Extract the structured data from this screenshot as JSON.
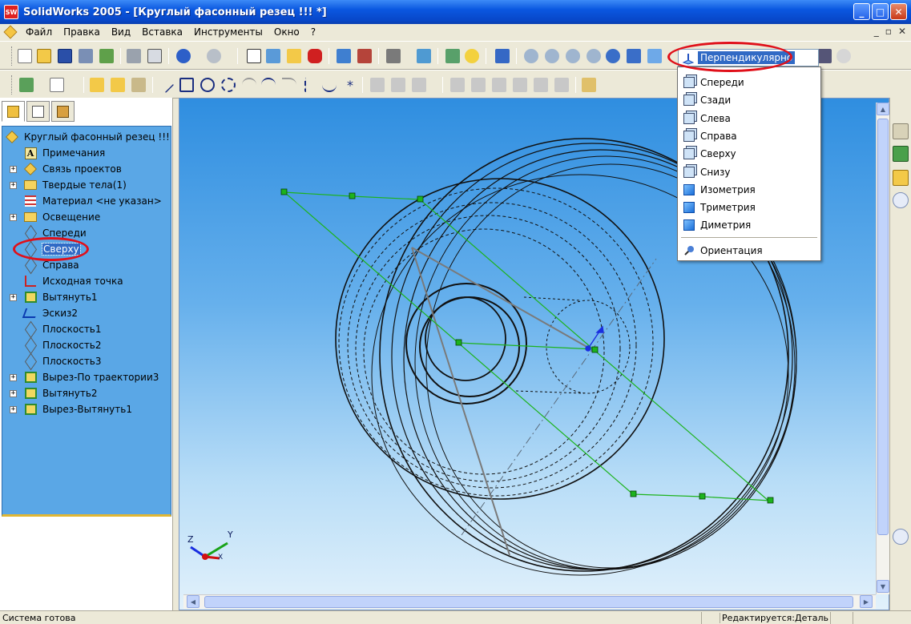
{
  "window": {
    "title": "SolidWorks 2005 - [Круглый фасонный резец !!! *]",
    "app_icon_text": "SW",
    "minimize_glyph": "_",
    "maximize_glyph": "□",
    "close_glyph": "✕"
  },
  "menu": {
    "items": [
      "Файл",
      "Правка",
      "Вид",
      "Вставка",
      "Инструменты",
      "Окно",
      "?"
    ],
    "doc_controls": [
      "_",
      "▫",
      "✕"
    ]
  },
  "feature_tree": {
    "root": "Круглый фасонный резец !!!",
    "items": [
      {
        "label": "Примечания",
        "icon": "annotation-icon",
        "expand": ""
      },
      {
        "label": "Связь проектов",
        "icon": "link-icon",
        "expand": "+"
      },
      {
        "label": "Твердые тела(1)",
        "icon": "folder-icon",
        "expand": "+"
      },
      {
        "label": "Материал <не указан>",
        "icon": "material-icon",
        "expand": ""
      },
      {
        "label": "Освещение",
        "icon": "light-folder-icon",
        "expand": "+"
      },
      {
        "label": "Спереди",
        "icon": "plane-icon",
        "expand": ""
      },
      {
        "label": "Сверху",
        "icon": "plane-icon",
        "expand": "",
        "selected": true
      },
      {
        "label": "Справа",
        "icon": "plane-icon",
        "expand": ""
      },
      {
        "label": "Исходная точка",
        "icon": "origin-icon",
        "expand": ""
      },
      {
        "label": "Вытянуть1",
        "icon": "extrude-icon",
        "expand": "+"
      },
      {
        "label": "Эскиз2",
        "icon": "sketch-icon",
        "expand": ""
      },
      {
        "label": "Плоскость1",
        "icon": "plane-icon",
        "expand": ""
      },
      {
        "label": "Плоскость2",
        "icon": "plane-icon",
        "expand": ""
      },
      {
        "label": "Плоскость3",
        "icon": "plane-icon",
        "expand": ""
      },
      {
        "label": "Вырез-По траектории3",
        "icon": "sweep-cut-icon",
        "expand": "+"
      },
      {
        "label": "Вытянуть2",
        "icon": "extrude-icon",
        "expand": "+"
      },
      {
        "label": "Вырез-Вытянуть1",
        "icon": "extrude-cut-icon",
        "expand": "+"
      }
    ]
  },
  "view_orientation": {
    "current": "Перпендикулярно",
    "options": [
      {
        "label": "Спереди",
        "icon": "wire-cube-icon"
      },
      {
        "label": "Сзади",
        "icon": "wire-cube-icon"
      },
      {
        "label": "Слева",
        "icon": "wire-cube-icon"
      },
      {
        "label": "Справа",
        "icon": "wire-cube-icon"
      },
      {
        "label": "Сверху",
        "icon": "wire-cube-icon"
      },
      {
        "label": "Снизу",
        "icon": "wire-cube-icon"
      },
      {
        "label": "Изометрия",
        "icon": "solid-cube-icon"
      },
      {
        "label": "Триметрия",
        "icon": "solid-cube-icon"
      },
      {
        "label": "Диметрия",
        "icon": "solid-cube-icon"
      }
    ],
    "footer": "Ориентация"
  },
  "triad": {
    "x": "X",
    "y": "Y",
    "z": "Z"
  },
  "status": {
    "left": "Система готова",
    "right": "Редактируется:Деталь"
  },
  "colors": {
    "highlight_ring": "#e0101a",
    "selection": "#316ac5",
    "tree_background": "#5aa7e6",
    "sketch_green": "#1db31d"
  }
}
